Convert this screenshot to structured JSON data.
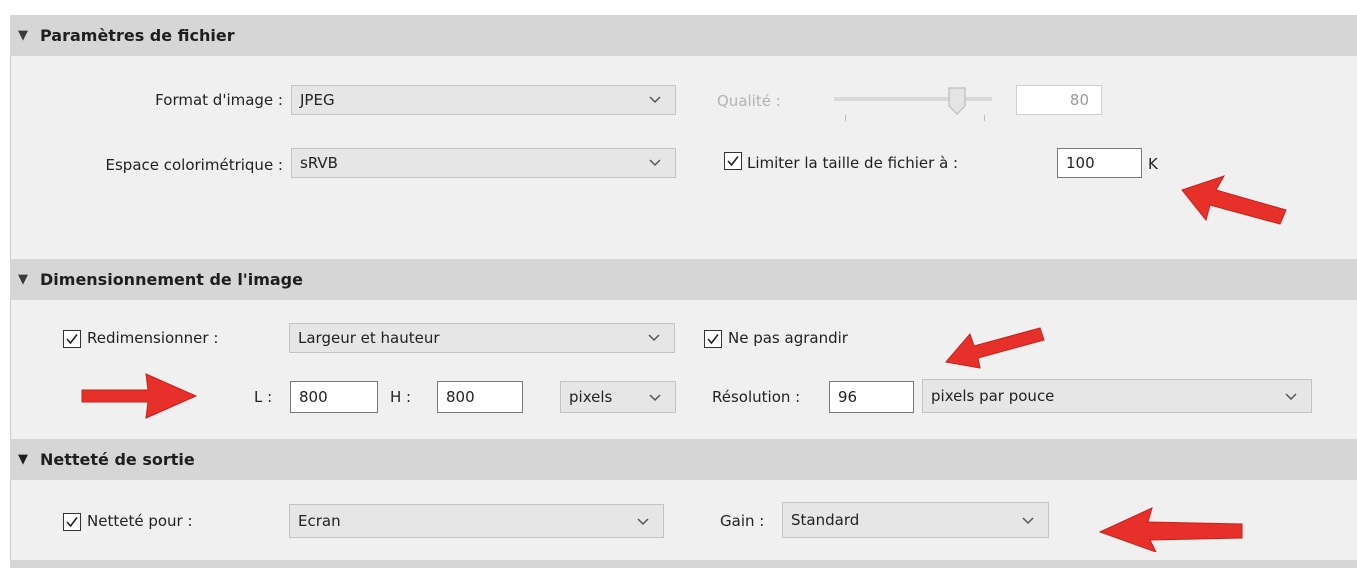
{
  "sections": {
    "file": {
      "title": "Paramètres de fichier",
      "format_label": "Format d'image :",
      "format_value": "JPEG",
      "quality_label": "Qualité :",
      "quality_value": "80",
      "quality_level_percent": 80,
      "colorspace_label": "Espace colorimétrique :",
      "colorspace_value": "sRVB",
      "limit_checked": true,
      "limit_label": "Limiter la taille de fichier à :",
      "limit_value": "100",
      "limit_unit": "K"
    },
    "sizing": {
      "title": "Dimensionnement de l'image",
      "resize_checked": true,
      "resize_label": "Redimensionner :",
      "resize_mode": "Largeur et hauteur",
      "no_enlarge_checked": true,
      "no_enlarge_label": "Ne pas agrandir",
      "width_label": "L :",
      "width_value": "800",
      "height_label": "H :",
      "height_value": "800",
      "unit_value": "pixels",
      "resolution_label": "Résolution :",
      "resolution_value": "96",
      "resolution_unit": "pixels par pouce"
    },
    "sharpen": {
      "title": "Netteté de sortie",
      "sharpen_checked": true,
      "sharpen_label": "Netteté pour :",
      "sharpen_target": "Ecran",
      "gain_label": "Gain :",
      "gain_value": "Standard"
    }
  },
  "colors": {
    "annotation_arrow": "#e8302a",
    "header_bg": "#d6d6d6",
    "panel_bg": "#f0f0f0"
  },
  "icons": {
    "collapse": "triangle-down-icon",
    "dropdown": "chevron-down-icon",
    "checkbox": "checkmark-icon",
    "annotation": "red-arrow-icon"
  }
}
